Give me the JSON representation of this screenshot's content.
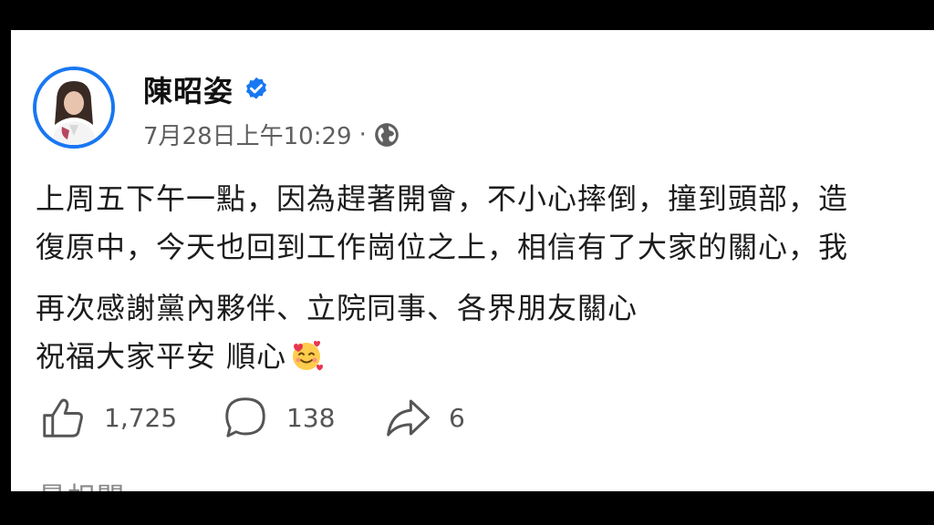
{
  "post": {
    "author": "陳昭姿",
    "timestamp": "7月28日上午10:29",
    "separator": "·",
    "privacy_icon": "globe-icon",
    "verified_icon": "verified-badge-icon",
    "lines": [
      "上周五下午一點，因為趕著開會，不小心摔倒，撞到頭部，造",
      "復原中，今天也回到工作崗位之上，相信有了大家的關心，我",
      "再次感謝黨內夥伴、立院同事、各界朋友關心",
      "祝福大家平安 順心"
    ],
    "emoji": "smiling-face-with-hearts"
  },
  "actions": {
    "like_count": "1,725",
    "comment_count": "138",
    "share_count": "6"
  },
  "footer": {
    "cut_text": "最相關"
  },
  "colors": {
    "accent": "#1877f2",
    "frame": "#000000",
    "background": "#ffffff"
  }
}
